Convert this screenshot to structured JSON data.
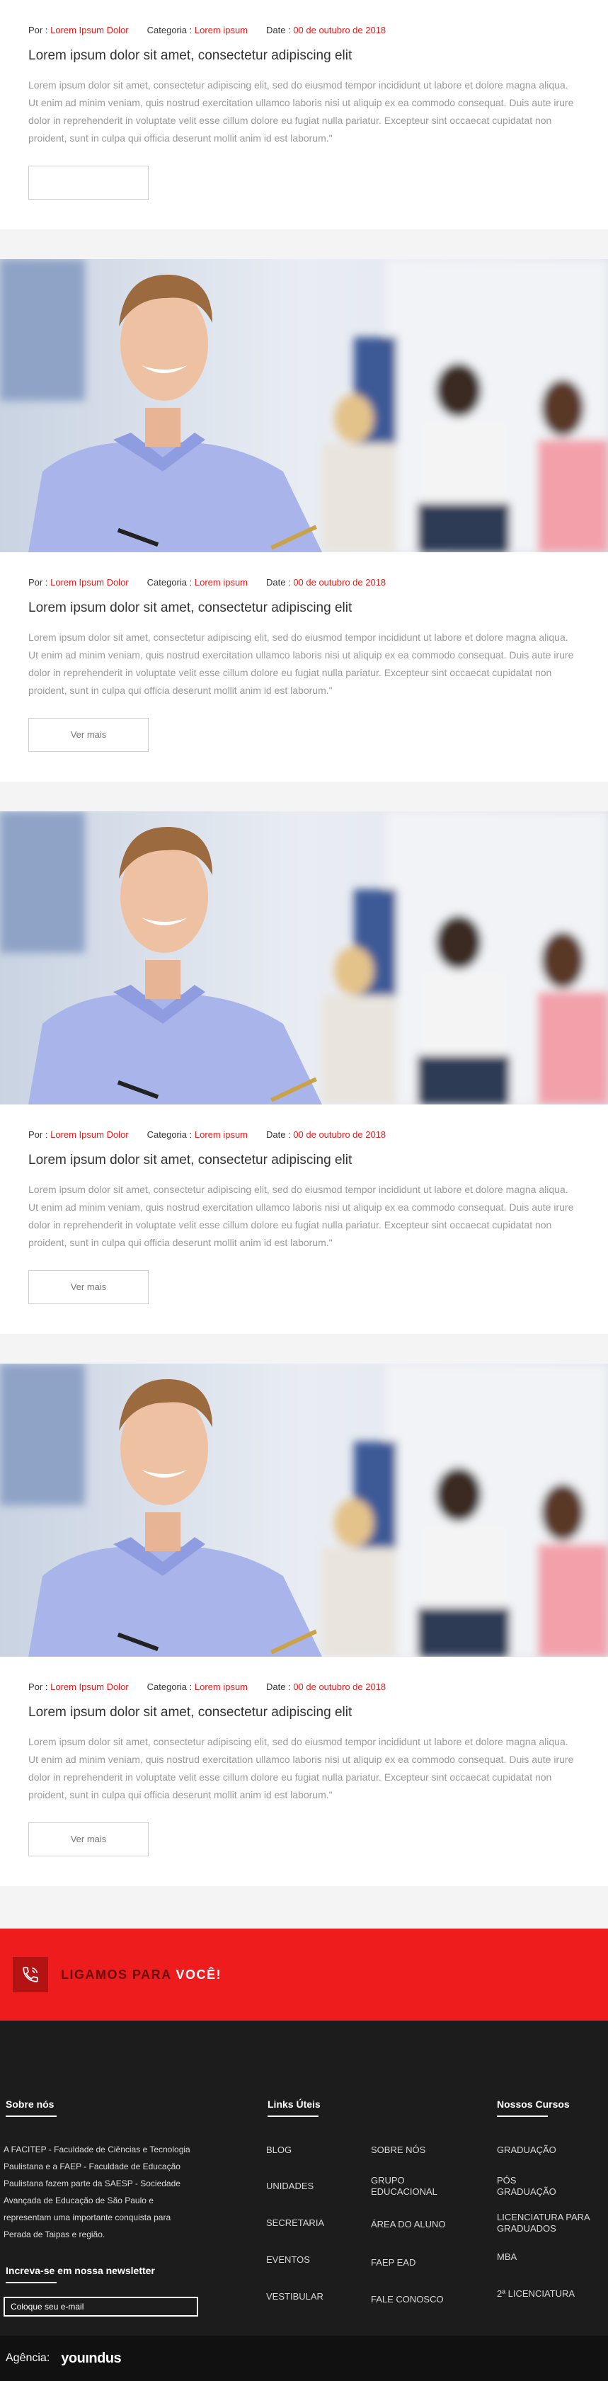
{
  "posts": [
    {
      "author_label": "Por :",
      "author": "Lorem Ipsum Dolor",
      "category_label": "Categoria :",
      "category": "Lorem ipsum",
      "date_label": "Date :",
      "date": "00 de outubro de 2018",
      "title": "Lorem ipsum dolor sit amet, consectetur adipiscing elit",
      "excerpt": "Lorem ipsum dolor sit amet, consectetur adipiscing elit, sed do eiusmod tempor incididunt ut labore et dolore magna aliqua. Ut enim ad minim veniam, quis nostrud exercitation ullamco laboris nisi ut aliquip ex ea commodo consequat. Duis aute irure dolor in reprehenderit in voluptate velit esse cillum dolore eu fugiat nulla pariatur. Excepteur sint occaecat cupidatat non proident, sunt in culpa qui officia deserunt mollit anim id est laborum.\"",
      "button": ""
    },
    {
      "author_label": "Por :",
      "author": "Lorem Ipsum Dolor",
      "category_label": "Categoria :",
      "category": "Lorem ipsum",
      "date_label": "Date :",
      "date": "00 de outubro de 2018",
      "title": "Lorem ipsum dolor sit amet, consectetur adipiscing elit",
      "excerpt": "Lorem ipsum dolor sit amet, consectetur adipiscing elit, sed do eiusmod tempor incididunt ut labore et dolore magna aliqua. Ut enim ad minim veniam, quis nostrud exercitation ullamco laboris nisi ut aliquip ex ea commodo consequat. Duis aute irure dolor in reprehenderit in voluptate velit esse cillum dolore eu fugiat nulla pariatur. Excepteur sint occaecat cupidatat non proident, sunt in culpa qui officia deserunt mollit anim id est laborum.\"",
      "button": "Ver mais"
    },
    {
      "author_label": "Por :",
      "author": "Lorem Ipsum Dolor",
      "category_label": "Categoria :",
      "category": "Lorem ipsum",
      "date_label": "Date :",
      "date": "00 de outubro de 2018",
      "title": "Lorem ipsum dolor sit amet, consectetur adipiscing elit",
      "excerpt": "Lorem ipsum dolor sit amet, consectetur adipiscing elit, sed do eiusmod tempor incididunt ut labore et dolore magna aliqua. Ut enim ad minim veniam, quis nostrud exercitation ullamco laboris nisi ut aliquip ex ea commodo consequat. Duis aute irure dolor in reprehenderit in voluptate velit esse cillum dolore eu fugiat nulla pariatur. Excepteur sint occaecat cupidatat non proident, sunt in culpa qui officia deserunt mollit anim id est laborum.\"",
      "button": "Ver mais"
    },
    {
      "author_label": "Por :",
      "author": "Lorem Ipsum Dolor",
      "category_label": "Categoria :",
      "category": "Lorem ipsum",
      "date_label": "Date :",
      "date": "00 de outubro de 2018",
      "title": "Lorem ipsum dolor sit amet, consectetur adipiscing elit",
      "excerpt": "Lorem ipsum dolor sit amet, consectetur adipiscing elit, sed do eiusmod tempor incididunt ut labore et dolore magna aliqua. Ut enim ad minim veniam, quis nostrud exercitation ullamco laboris nisi ut aliquip ex ea commodo consequat. Duis aute irure dolor in reprehenderit in voluptate velit esse cillum dolore eu fugiat nulla pariatur. Excepteur sint occaecat cupidatat non proident, sunt in culpa qui officia deserunt mollit anim id est laborum.\"",
      "button": "Ver mais"
    }
  ],
  "callband": {
    "text_prefix": "LIGAMOS PARA ",
    "text_highlight": "VOCÊ!",
    "icon": "phone-icon"
  },
  "footer": {
    "about_heading": "Sobre nós",
    "about_text": "A FACITEP - Faculdade de Ciências e Tecnologia Paulistana e a FAEP - Faculdade de Educação Paulistana fazem parte da SAESP - Sociedade Avançada de Educação de São Paulo e representam uma importante conquista para Perada de Taipas e região.",
    "newsletter_heading": "Increva-se em nossa newsletter",
    "newsletter_placeholder": "Coloque seu e-mail",
    "links_heading": "Links Úteis",
    "links_col1": [
      "BLOG",
      "UNIDADES",
      "SECRETARIA",
      "EVENTOS",
      "VESTIBULAR"
    ],
    "links_col2": [
      "SOBRE NÓS",
      "GRUPO EDUCACIONAL",
      "ÁREA DO ALUNO",
      "FAEP EAD",
      "FALE CONOSCO"
    ],
    "courses_heading": "Nossos Cursos",
    "courses": [
      "GRADUAÇÃO",
      "PÓS GRADUAÇÃO",
      "LICENCIATURA PARA GRADUADOS",
      "MBA",
      "2ª LICENCIATURA"
    ]
  },
  "agency": {
    "label": "Agência:",
    "logo": "youındus"
  },
  "colors": {
    "accent": "#e02020",
    "band": "#ee1c1c",
    "footer_bg": "#1c1c1c"
  }
}
